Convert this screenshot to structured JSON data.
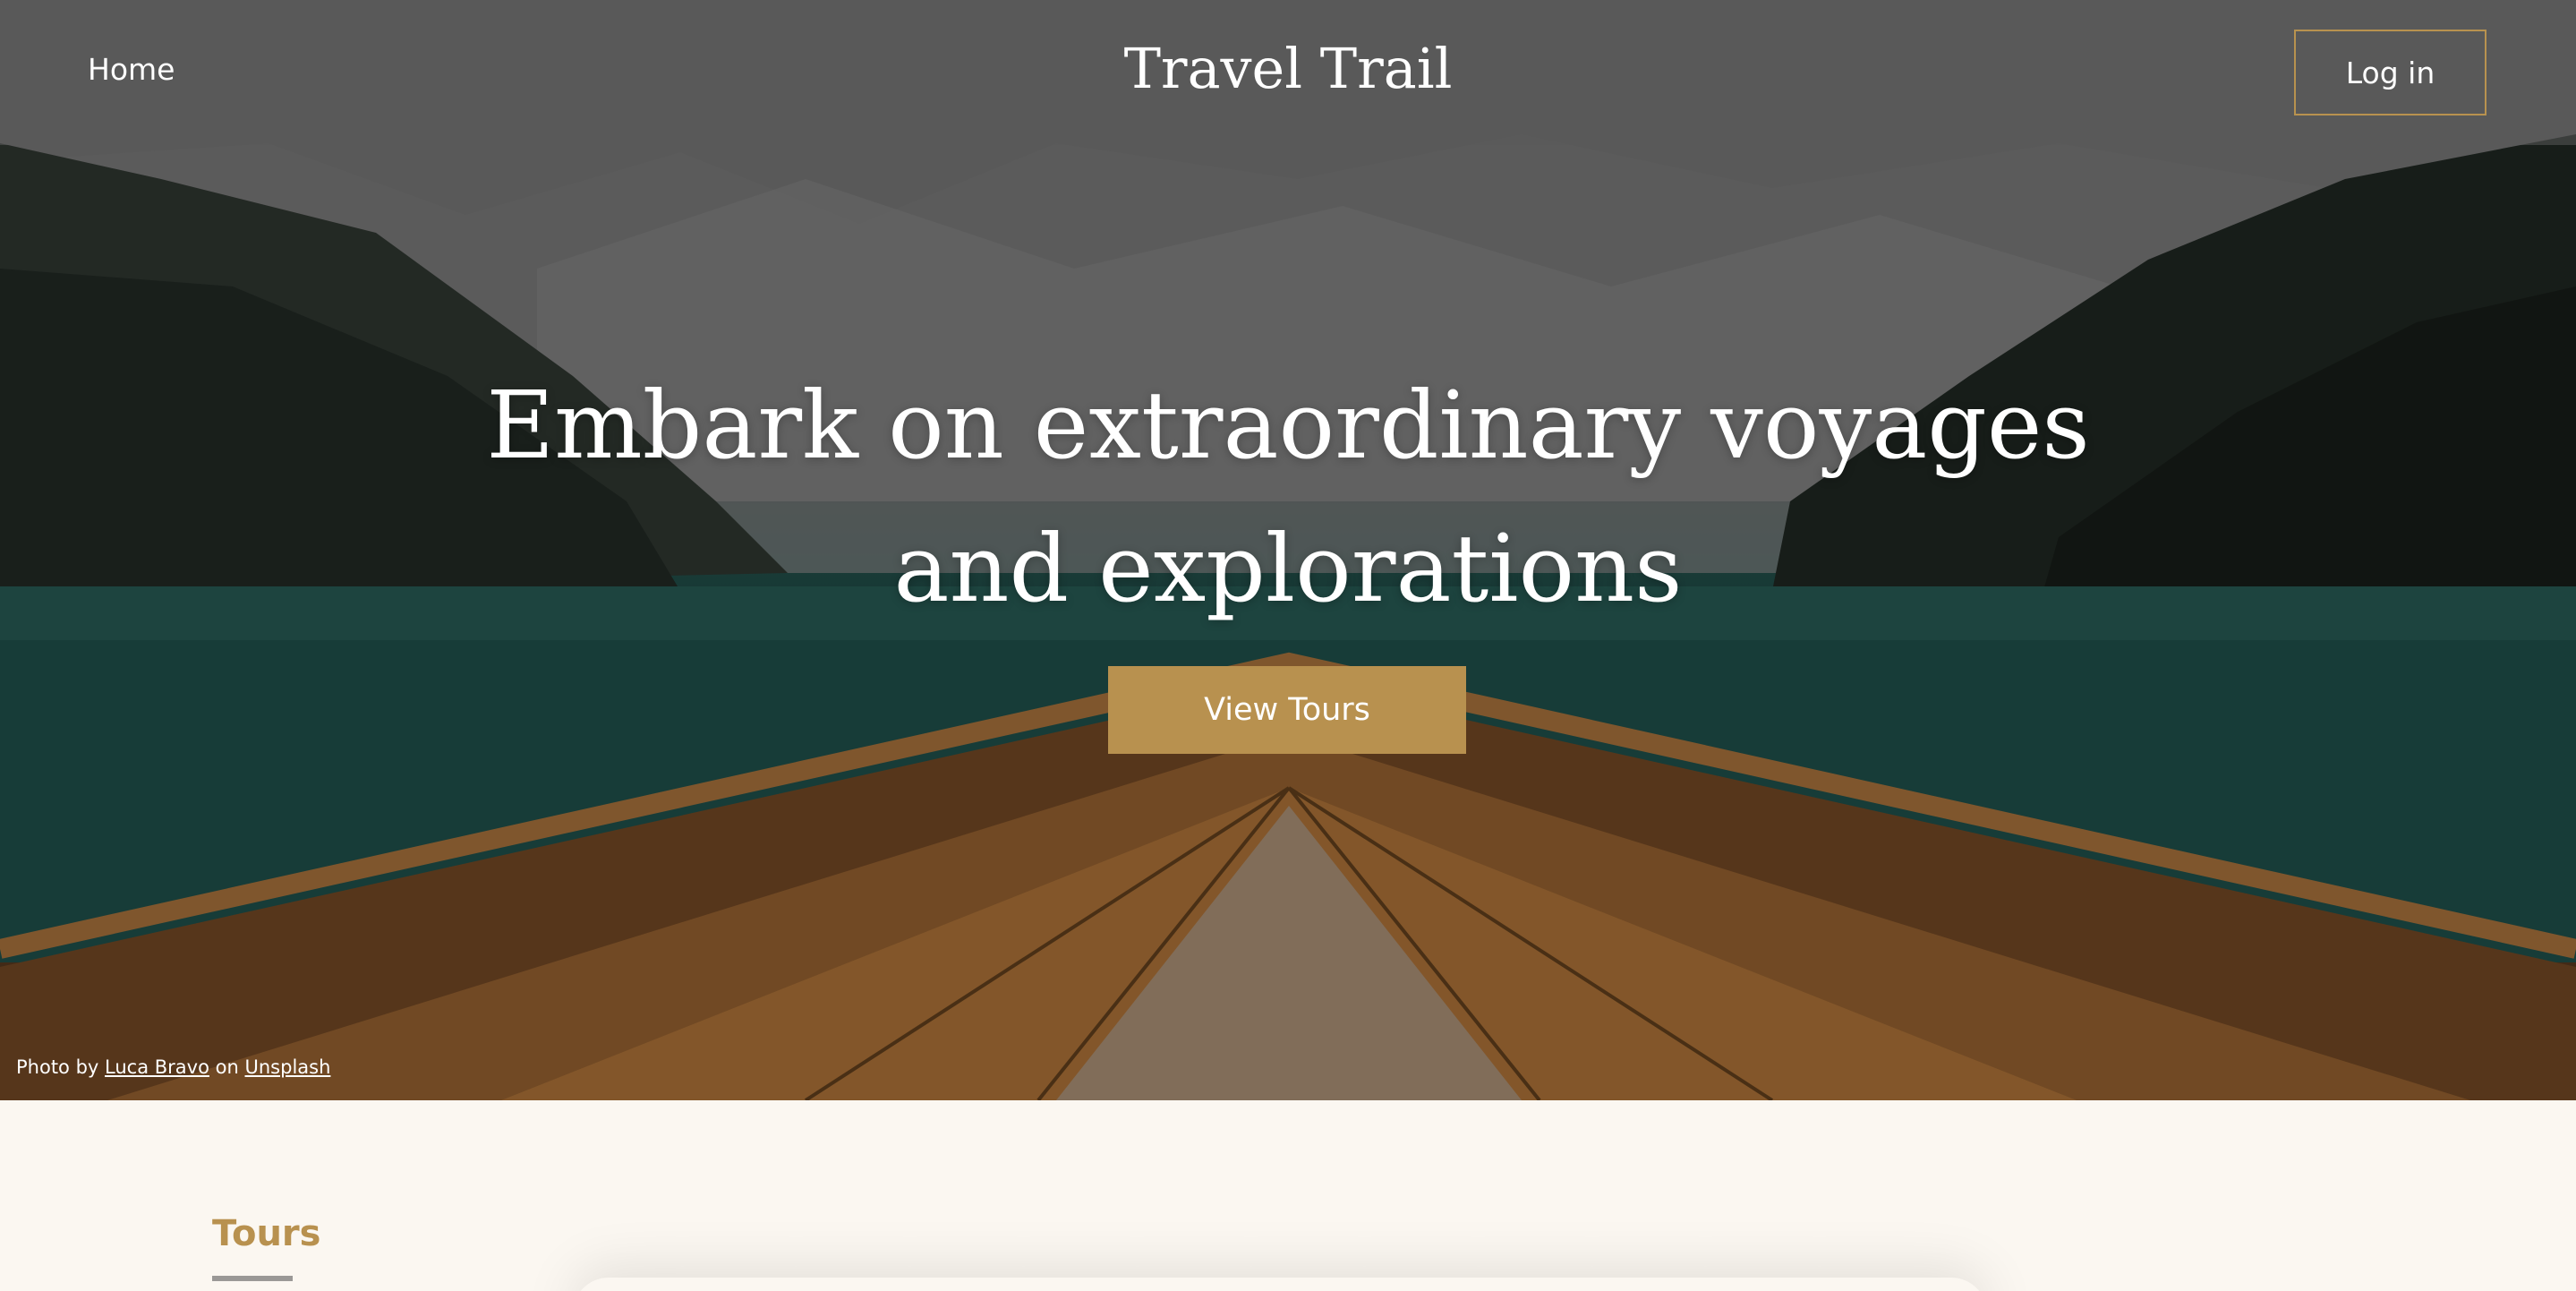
{
  "navbar": {
    "home_label": "Home",
    "brand": "Travel Trail",
    "login_label": "Log in"
  },
  "hero": {
    "headline_line1": "Embark on extraordinary voyages",
    "headline_line2": "and explorations",
    "cta_label": "View Tours",
    "credit": {
      "prefix": "Photo by",
      "author": "Luca Bravo",
      "middle": "on",
      "source": "Unsplash"
    }
  },
  "tours": {
    "label": "Tours"
  },
  "colors": {
    "accent": "#b8914f",
    "page_background": "#fbf7f1"
  }
}
